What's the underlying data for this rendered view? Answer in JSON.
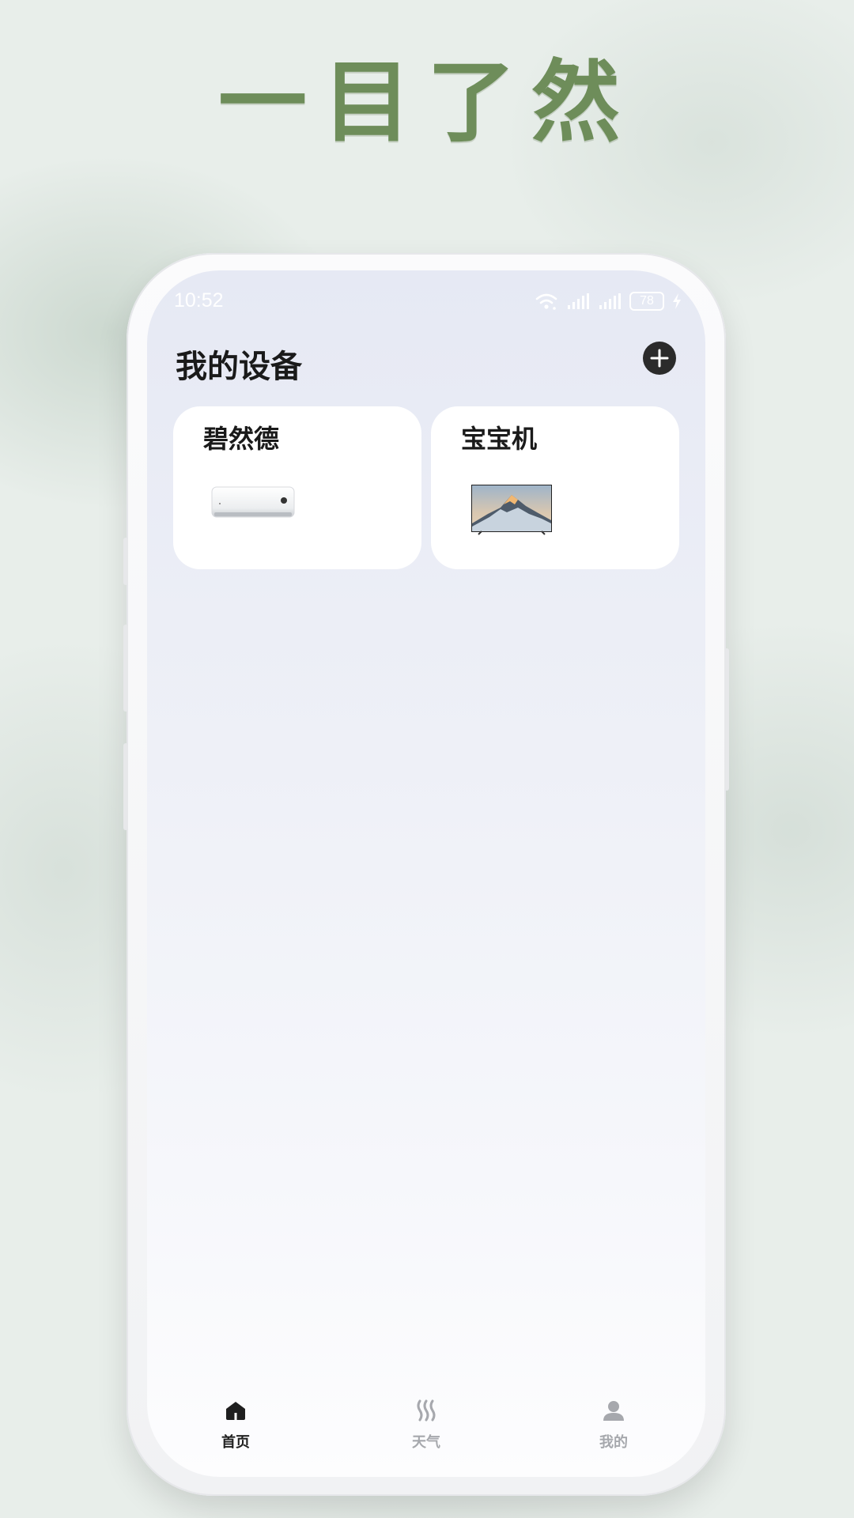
{
  "headline": "一目了然",
  "status_bar": {
    "time": "10:52",
    "battery": "78",
    "icons": [
      "wifi-icon",
      "signal-icon",
      "signal-icon",
      "battery-icon",
      "charging-icon"
    ]
  },
  "header": {
    "title": "我的设备",
    "add_icon": "plus-icon"
  },
  "devices": [
    {
      "name": "碧然德",
      "image": "air-conditioner"
    },
    {
      "name": "宝宝机",
      "image": "television"
    }
  ],
  "tab_bar": {
    "active": 0,
    "items": [
      {
        "label": "首页",
        "icon": "home-icon"
      },
      {
        "label": "天气",
        "icon": "weather-icon"
      },
      {
        "label": "我的",
        "icon": "person-icon"
      }
    ]
  },
  "colors": {
    "headline": "#6e8d5a",
    "active_tab": "#1f1f1f",
    "inactive_tab": "#a6a8ad"
  }
}
